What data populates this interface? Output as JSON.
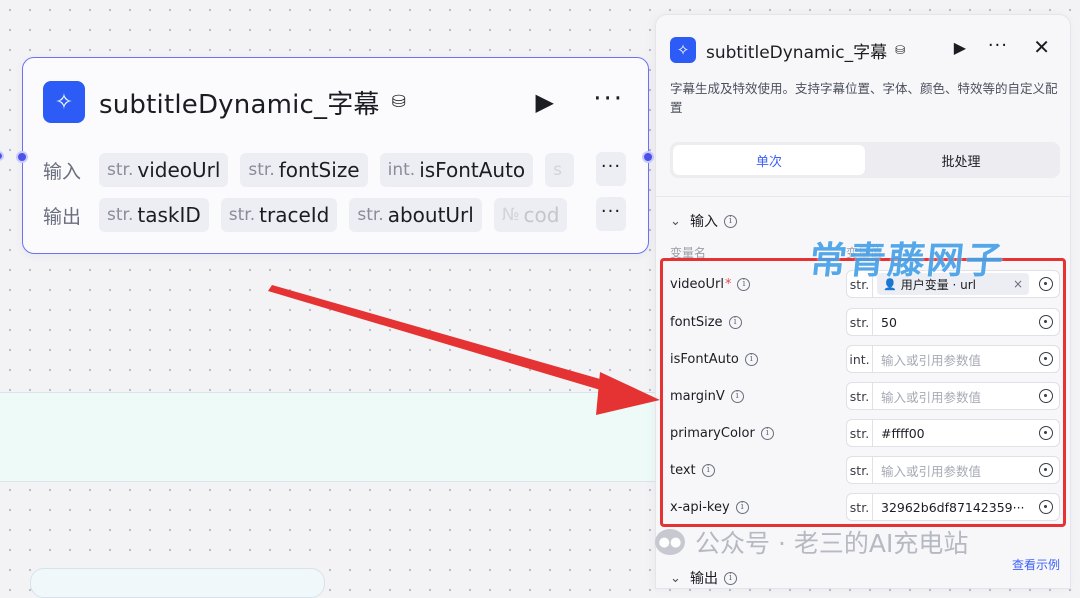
{
  "canvas": {
    "node": {
      "title": "subtitleDynamic_字幕",
      "inputs_label": "输入",
      "outputs_label": "输出",
      "inputs": [
        {
          "type": "str.",
          "name": "videoUrl"
        },
        {
          "type": "str.",
          "name": "fontSize"
        },
        {
          "type": "int.",
          "name": "isFontAuto"
        },
        {
          "type": "s",
          "name": ""
        }
      ],
      "outputs": [
        {
          "type": "str.",
          "name": "taskID"
        },
        {
          "type": "str.",
          "name": "traceId"
        },
        {
          "type": "str.",
          "name": "aboutUrl"
        },
        {
          "type": "№",
          "name": "cod"
        }
      ],
      "more": "···"
    }
  },
  "panel": {
    "title": "subtitleDynamic_字幕",
    "description": "字幕生成及特效使用。支持字幕位置、字体、颜色、特效等的自定义配置",
    "tabs": [
      "单次",
      "批处理"
    ],
    "input_section": "输入",
    "col_name": "变量名",
    "col_value": "变量值",
    "params": [
      {
        "name": "videoUrl",
        "required": "*",
        "type": "str.",
        "value": "用户变量 · url",
        "placeholder": ""
      },
      {
        "name": "fontSize",
        "required": "",
        "type": "str.",
        "value": "50",
        "placeholder": ""
      },
      {
        "name": "isFontAuto",
        "required": "",
        "type": "int.",
        "value": "",
        "placeholder": "输入或引用参数值"
      },
      {
        "name": "marginV",
        "required": "",
        "type": "str.",
        "value": "",
        "placeholder": "输入或引用参数值"
      },
      {
        "name": "primaryColor",
        "required": "",
        "type": "str.",
        "value": "#ffff00",
        "placeholder": ""
      },
      {
        "name": "text",
        "required": "",
        "type": "str.",
        "value": "",
        "placeholder": "输入或引用参数值"
      },
      {
        "name": "x-api-key",
        "required": "",
        "type": "str.",
        "value": "32962b6df87142359···",
        "placeholder": ""
      }
    ],
    "output_section": "输出",
    "examples_link": "查看示例"
  },
  "watermarks": {
    "top": "常青藤网子",
    "bottom": "公众号 · 老三的AI充电站"
  },
  "colors": {
    "accent": "#4d53e8",
    "brand_icon": "#2c5cf5",
    "highlight": "#e53333",
    "arrow": "#e53333"
  }
}
